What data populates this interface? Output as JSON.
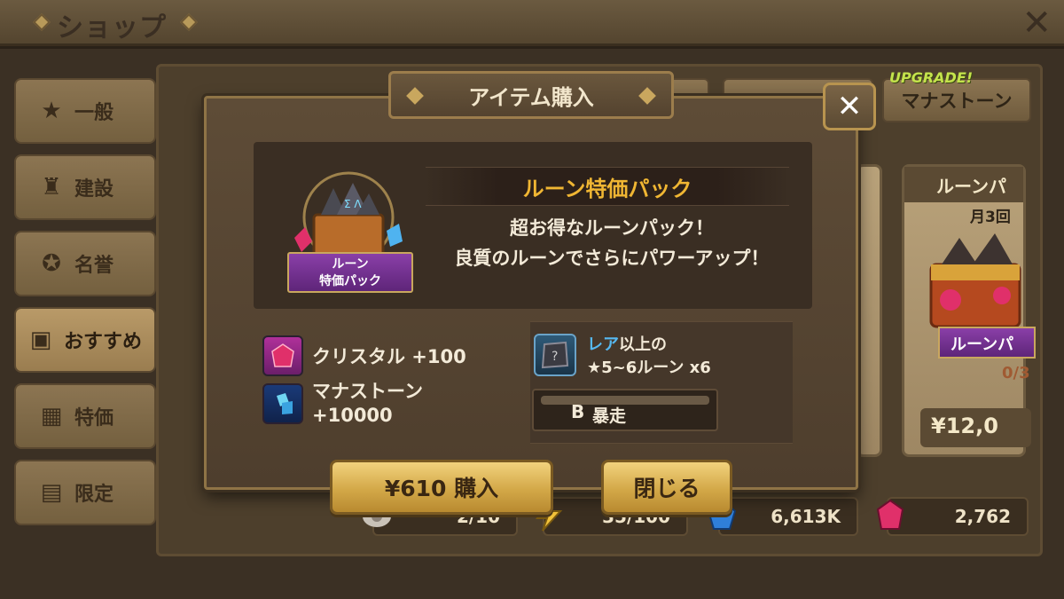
{
  "header": {
    "title": "ショップ"
  },
  "sidebar": {
    "items": [
      {
        "label": "一般",
        "icon": "star-icon"
      },
      {
        "label": "建設",
        "icon": "building-icon"
      },
      {
        "label": "名誉",
        "icon": "medal-icon"
      },
      {
        "label": "おすすめ",
        "icon": "gift-basket-icon",
        "active": true
      },
      {
        "label": "特価",
        "icon": "gift-box-icon"
      },
      {
        "label": "限定",
        "icon": "chest-icon"
      }
    ]
  },
  "tabs": {
    "upgrade_tag": "UPGRADE!",
    "mana_tab": "マナストーン"
  },
  "bg_card": {
    "title": "ルーンパ",
    "subtitle": "月3回",
    "price": "¥12,0",
    "count": "0/3",
    "banner": "ルーンパ"
  },
  "resources": {
    "scrolls": "2/10",
    "energy": "35/100",
    "mana": "6,613K",
    "crystal": "2,762"
  },
  "modal": {
    "title": "アイテム購入",
    "close_label": "✕",
    "pack_name": "ルーン特価パック",
    "pack_banner_line1": "ルーン",
    "pack_banner_line2": "特価パック",
    "description_line1": "超お得なルーンパック！",
    "description_line2": "良質のルーンでさらにパワーアップ！",
    "rewards": [
      {
        "label": "クリスタル +100",
        "icon": "crystal-icon"
      },
      {
        "label_line1": "マナストーン",
        "label_line2": "+10000",
        "icon": "mana-stone-icon"
      }
    ],
    "rune_reward": {
      "rare_word": "レア",
      "line1_suffix": "以上の",
      "line2": "★5~6ルーン x6",
      "set_name": "暴走",
      "set_glyph": "B"
    },
    "buy_button": "¥610 購入",
    "close_button": "閉じる"
  },
  "colors": {
    "gold_button": "#d3a848",
    "pack_name": "#f0b633",
    "rare_blue": "#56b8f0",
    "crystal_pink": "#e0306a"
  }
}
